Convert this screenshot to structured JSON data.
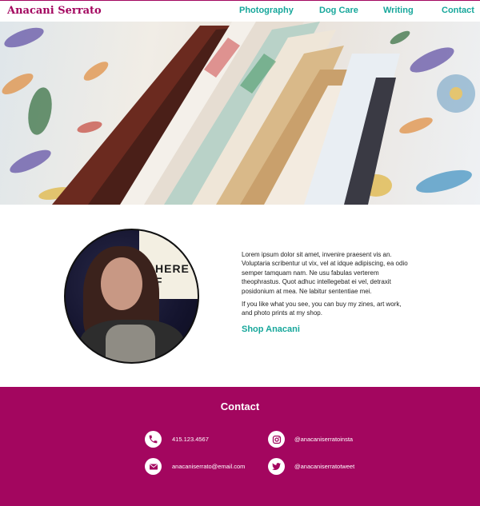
{
  "header": {
    "brand": "Anacani Serrato",
    "nav": [
      "Photography",
      "Dog Care",
      "Writing",
      "Contact"
    ]
  },
  "hero": {
    "icon": "notebooks-and-feathers-photo"
  },
  "about": {
    "avatar_sign_text": "HERE F",
    "paragraph1": "Lorem ipsum dolor sit amet, invenire praesent vis an. Voluptaria scribentur ut vix, vel at idque adipiscing, ea odio semper tamquam nam. Ne usu fabulas verterem theophrastus. Quot adhuc intellegebat ei vel, detraxit posidonium at mea. Ne labitur sententiae mei.",
    "paragraph2": "If you like what you see, you can buy my zines, art work, and photo prints at my shop.",
    "shop_link": "Shop Anacani"
  },
  "footer": {
    "title": "Contact",
    "phone": "415.123.4567",
    "email": "anacaniserrato@email.com",
    "instagram": "@anacaniserratoinsta",
    "twitter": "@anacaniserratotweet"
  },
  "colors": {
    "brand": "#a3065f",
    "accent": "#17a79b"
  }
}
